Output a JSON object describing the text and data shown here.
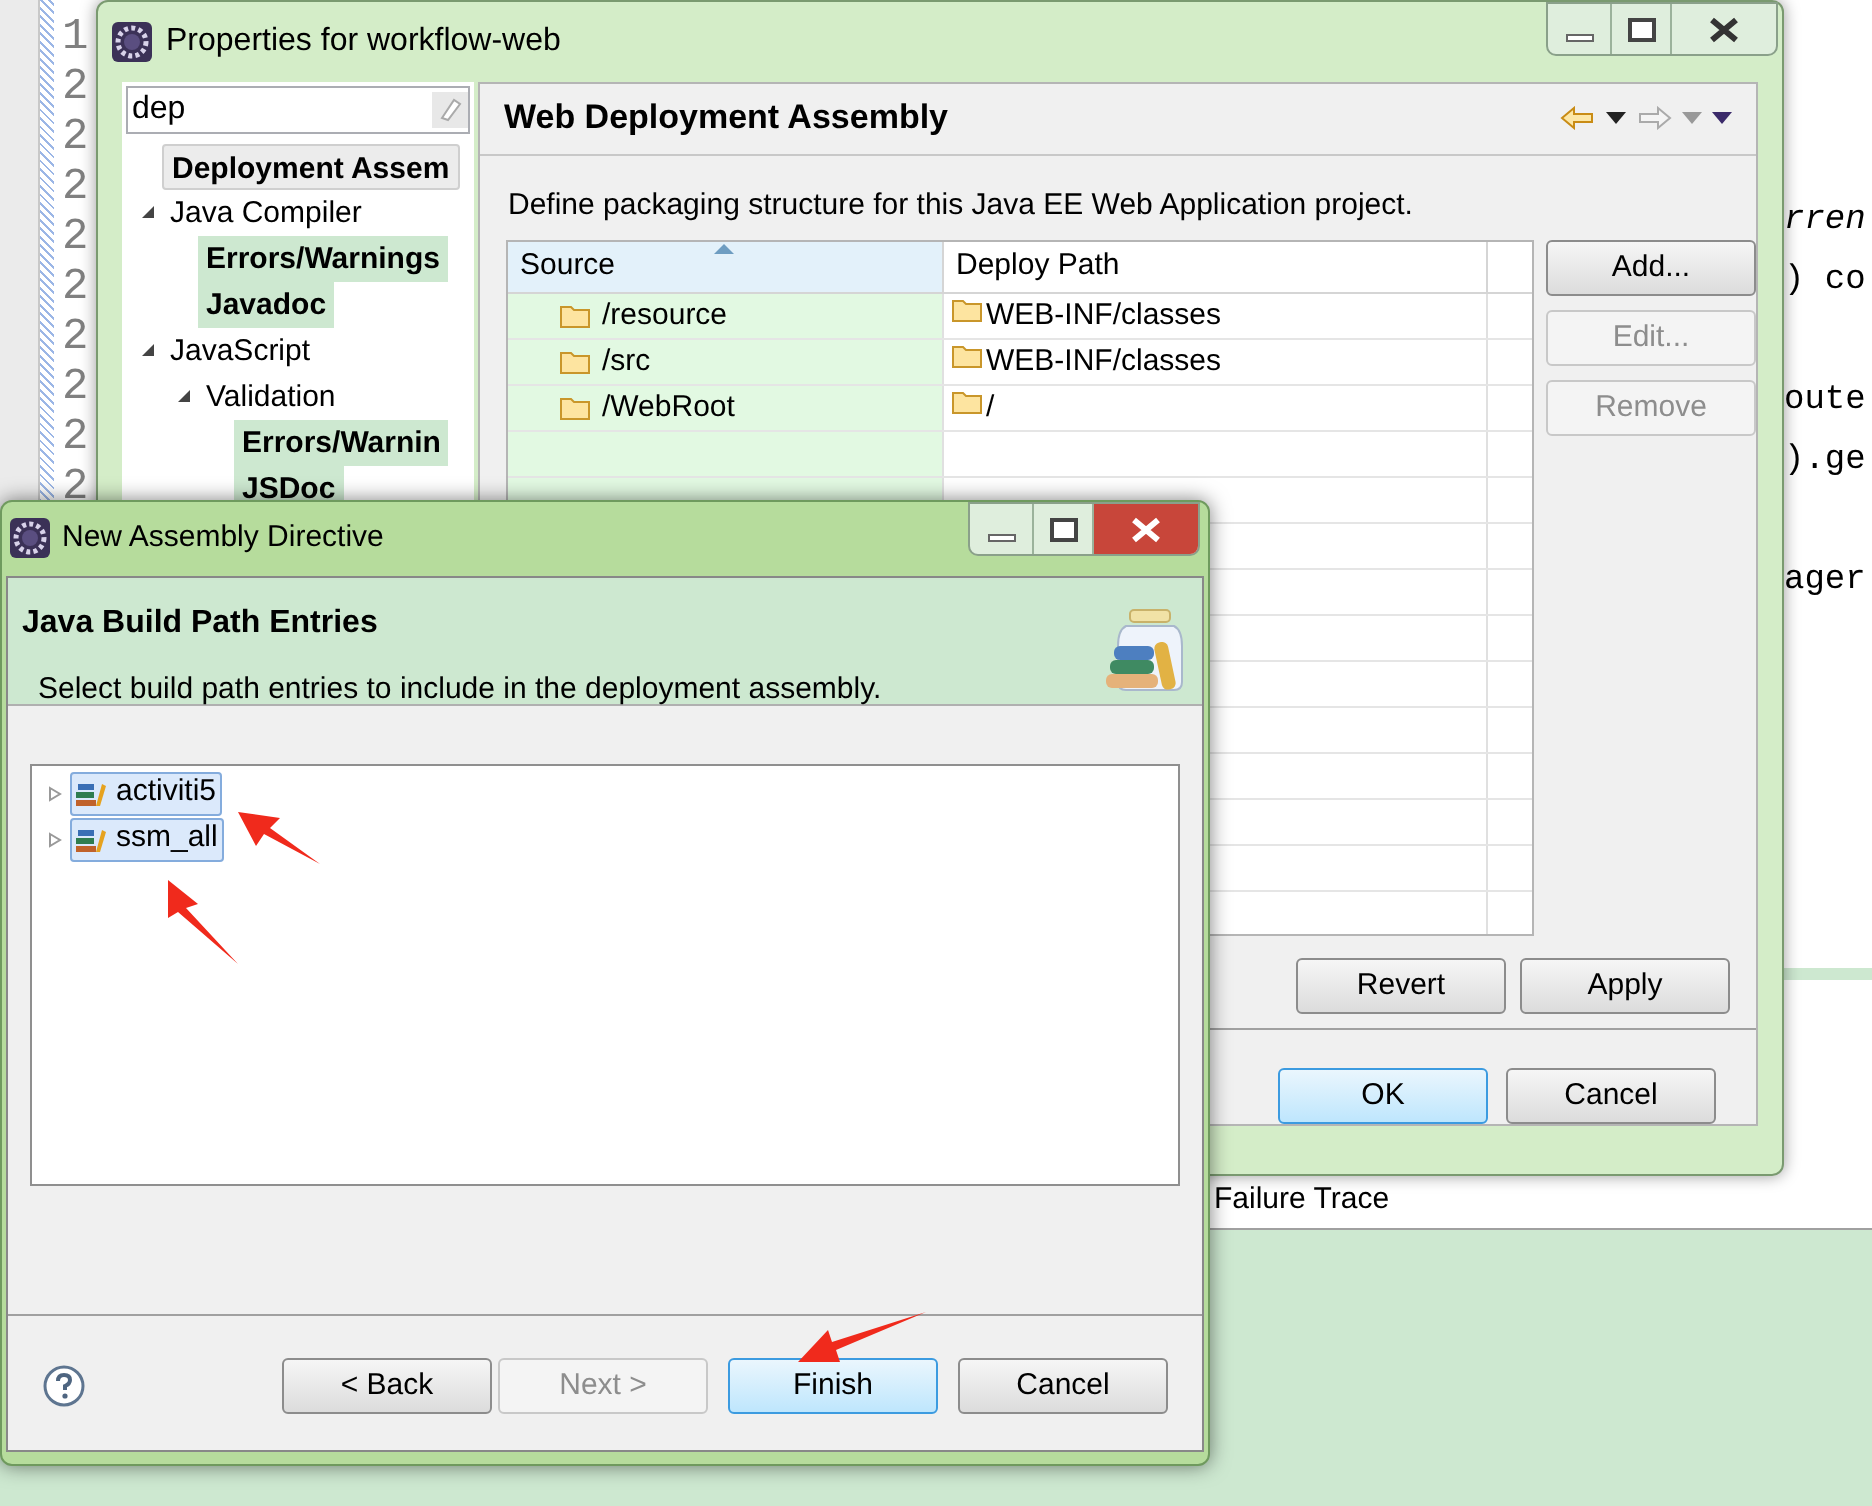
{
  "editor": {
    "line_numbers": [
      "1",
      "2",
      "2",
      "2",
      "2",
      "2",
      "2",
      "2",
      "2",
      "2"
    ],
    "code_blocks": [
      [
        {
          "text": "rren",
          "italic": true
        },
        {
          "text": ") co",
          "italic": false
        }
      ],
      [
        {
          "text": "oute",
          "italic": false
        },
        {
          "text": ").ge",
          "italic": false
        }
      ],
      [
        {
          "text": "ager",
          "italic": false
        }
      ]
    ]
  },
  "properties_window": {
    "title": "Properties for workflow-web",
    "filter": {
      "value": "dep"
    },
    "tree": [
      {
        "label": "Deployment Assem",
        "match": true,
        "selected": true
      },
      {
        "label": "Java Compiler",
        "match": false,
        "selected": false,
        "expanded": true,
        "children": [
          {
            "label": "Errors/Warnings",
            "match": true,
            "selected": false
          },
          {
            "label": "Javadoc",
            "match": true,
            "selected": false
          }
        ]
      },
      {
        "label": "JavaScript",
        "match": false,
        "selected": false,
        "expanded": true,
        "children": [
          {
            "label": "Validation",
            "match": false,
            "selected": false,
            "expanded": true,
            "children": [
              {
                "label": "Errors/Warnin",
                "match": true,
                "selected": false
              },
              {
                "label": "JSDoc",
                "match": true,
                "selected": false
              }
            ]
          }
        ]
      }
    ],
    "page_title": "Web Deployment Assembly",
    "description": "Define packaging structure for this Java EE Web Application project.",
    "table": {
      "columns": [
        "Source",
        "Deploy Path"
      ],
      "rows": [
        {
          "source": "/resource",
          "deploy_path": "WEB-INF/classes"
        },
        {
          "source": "/src",
          "deploy_path": "WEB-INF/classes"
        },
        {
          "source": "/WebRoot",
          "deploy_path": "/"
        }
      ]
    },
    "side_buttons": [
      {
        "label": "Add...",
        "disabled": false
      },
      {
        "label": "Edit...",
        "disabled": true
      },
      {
        "label": "Remove",
        "disabled": true
      }
    ],
    "page_buttons": [
      {
        "label": "Revert",
        "disabled": false
      },
      {
        "label": "Apply",
        "disabled": false
      }
    ],
    "dialog_buttons": [
      {
        "label": "OK",
        "default": true
      },
      {
        "label": "Cancel",
        "default": false
      }
    ]
  },
  "failure_trace": "Failure Trace",
  "wizard": {
    "title": "New Assembly Directive",
    "header_title": "Java Build Path Entries",
    "header_description": "Select build path entries to include in the deployment assembly.",
    "entries": [
      {
        "label": "activiti5",
        "selected": true,
        "expanded": false
      },
      {
        "label": "ssm_all",
        "selected": true,
        "expanded": false
      }
    ],
    "buttons": [
      {
        "label": "< Back",
        "disabled": false,
        "default": false
      },
      {
        "label": "Next >",
        "disabled": true,
        "default": false
      },
      {
        "label": "Finish",
        "disabled": false,
        "default": true
      },
      {
        "label": "Cancel",
        "disabled": false,
        "default": false
      }
    ]
  }
}
